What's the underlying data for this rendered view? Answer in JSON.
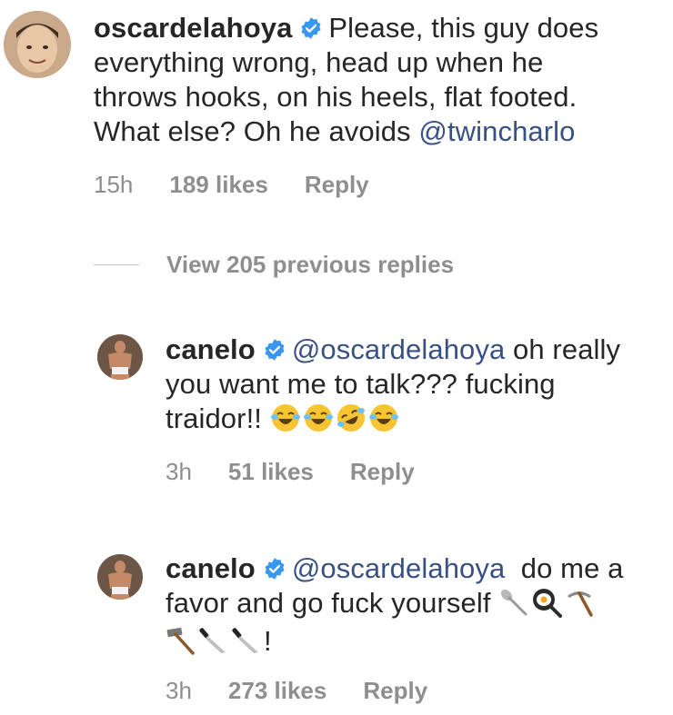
{
  "comments": [
    {
      "username": "oscardelahoya",
      "text_line1": "Please, this guy does",
      "text_line2": "everything wrong, head up when he",
      "text_line3": "throws hooks, on his heels, flat footed.",
      "text_line4": "What else? Oh he avoids ",
      "mention": "@twincharlo",
      "time": "15h",
      "likes": "189 likes",
      "reply": "Reply"
    },
    {
      "username": "canelo",
      "mention": "@oscardelahoya",
      "text_line1": " oh really",
      "text_line2": "you want me to talk??? fucking",
      "text_line3": "traidor!! ",
      "time": "3h",
      "likes": "51 likes",
      "reply": "Reply"
    },
    {
      "username": "canelo",
      "mention": "@oscardelahoya",
      "text_line1": "  do me a",
      "text_line2": "favor and go fuck yourself ",
      "text_line3_suffix": "!",
      "time": "3h",
      "likes": "273 likes",
      "reply": "Reply"
    }
  ],
  "view_replies": "View 205 previous replies",
  "colors": {
    "text": "#262626",
    "secondary": "#8e8e8e",
    "mention": "#385185",
    "verified": "#3897f0"
  }
}
